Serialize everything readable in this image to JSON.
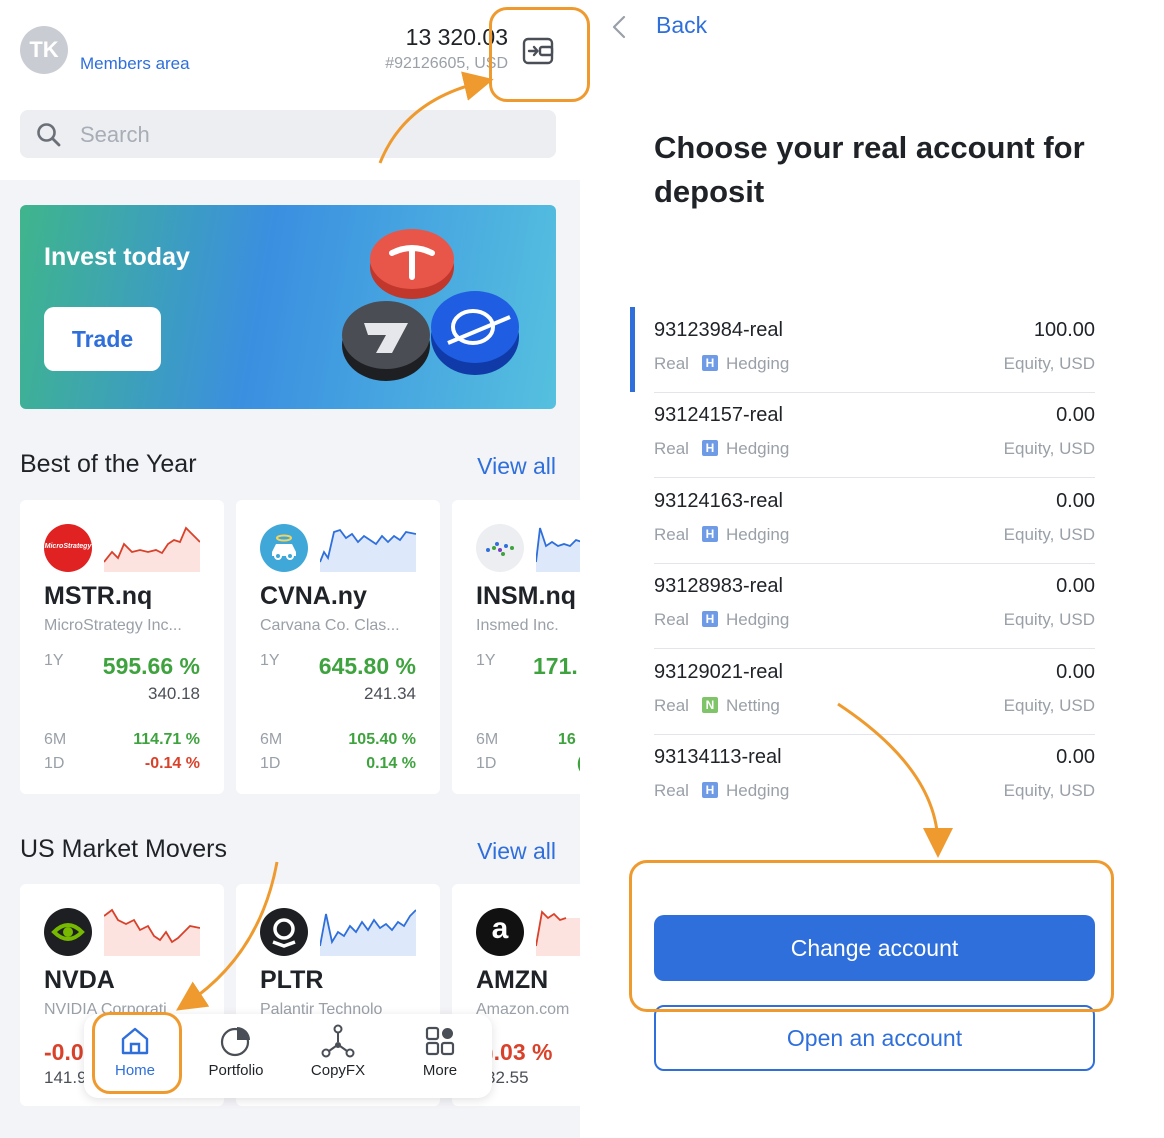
{
  "header": {
    "avatar_initials": "TK",
    "members_area": "Members area",
    "balance": "13 320.03",
    "account_number": "#92126605, USD",
    "wallet_icon": "deposit-wallet-icon"
  },
  "search": {
    "placeholder": "Search"
  },
  "banner": {
    "title": "Invest today",
    "button_label": "Trade"
  },
  "best_of_year": {
    "title": "Best of the Year",
    "view_all": "View all",
    "cards": [
      {
        "ticker": "MSTR.nq",
        "name": "MicroStrategy Inc...",
        "period_1y": "1Y",
        "change_1y": "595.66 %",
        "price": "340.18",
        "period_6m": "6M",
        "change_6m": "114.71 %",
        "period_1d": "1D",
        "change_1d": "-0.14 %",
        "logo_text": "MicroStrategy"
      },
      {
        "ticker": "CVNA.ny",
        "name": "Carvana Co. Clas...",
        "period_1y": "1Y",
        "change_1y": "645.80 %",
        "price": "241.34",
        "period_6m": "6M",
        "change_6m": "105.40 %",
        "period_1d": "1D",
        "change_1d": "0.14 %"
      },
      {
        "ticker": "INSM.nq",
        "name": "Insmed Inc.",
        "period_1y": "1Y",
        "change_1y": "171.",
        "price": "",
        "period_6m": "6M",
        "change_6m": "16",
        "period_1d": "1D",
        "change_1d": "("
      }
    ]
  },
  "market_movers": {
    "title": "US Market Movers",
    "view_all": "View all",
    "cards": [
      {
        "ticker": "NVDA",
        "name": "NVIDIA Corporati",
        "change": "-0.0",
        "price": "141.9"
      },
      {
        "ticker": "PLTR",
        "name": "Palantir Technolo",
        "change": "",
        "price": ""
      },
      {
        "ticker": "AMZN",
        "name": "Amazon.com",
        "change": ").03 %",
        "price": "32.55",
        "logo_text": "a"
      }
    ]
  },
  "tabbar": {
    "items": [
      {
        "label": "Home",
        "icon": "home-icon"
      },
      {
        "label": "Portfolio",
        "icon": "pie-chart-icon"
      },
      {
        "label": "CopyFX",
        "icon": "network-icon"
      },
      {
        "label": "More",
        "icon": "grid-icon"
      }
    ]
  },
  "deposit": {
    "back": "Back",
    "heading": "Choose your real account for deposit",
    "accounts": [
      {
        "id": "93123984-real",
        "amount": "100.00",
        "type": "Real",
        "badge": "H",
        "mode": "Hedging",
        "equity": "Equity, USD",
        "selected": true
      },
      {
        "id": "93124157-real",
        "amount": "0.00",
        "type": "Real",
        "badge": "H",
        "mode": "Hedging",
        "equity": "Equity, USD"
      },
      {
        "id": "93124163-real",
        "amount": "0.00",
        "type": "Real",
        "badge": "H",
        "mode": "Hedging",
        "equity": "Equity, USD"
      },
      {
        "id": "93128983-real",
        "amount": "0.00",
        "type": "Real",
        "badge": "H",
        "mode": "Hedging",
        "equity": "Equity, USD"
      },
      {
        "id": "93129021-real",
        "amount": "0.00",
        "type": "Real",
        "badge": "N",
        "mode": "Netting",
        "equity": "Equity, USD"
      },
      {
        "id": "93134113-real",
        "amount": "0.00",
        "type": "Real",
        "badge": "H",
        "mode": "Hedging",
        "equity": "Equity, USD"
      }
    ],
    "change_account": "Change account",
    "open_account": "Open an account"
  },
  "colors": {
    "accent": "#2f6fdc",
    "highlight": "#ef9a2e",
    "positive": "#3ea33e",
    "negative": "#d9412a",
    "badge_hedging": "#6f9be6",
    "badge_netting": "#7fc469"
  }
}
